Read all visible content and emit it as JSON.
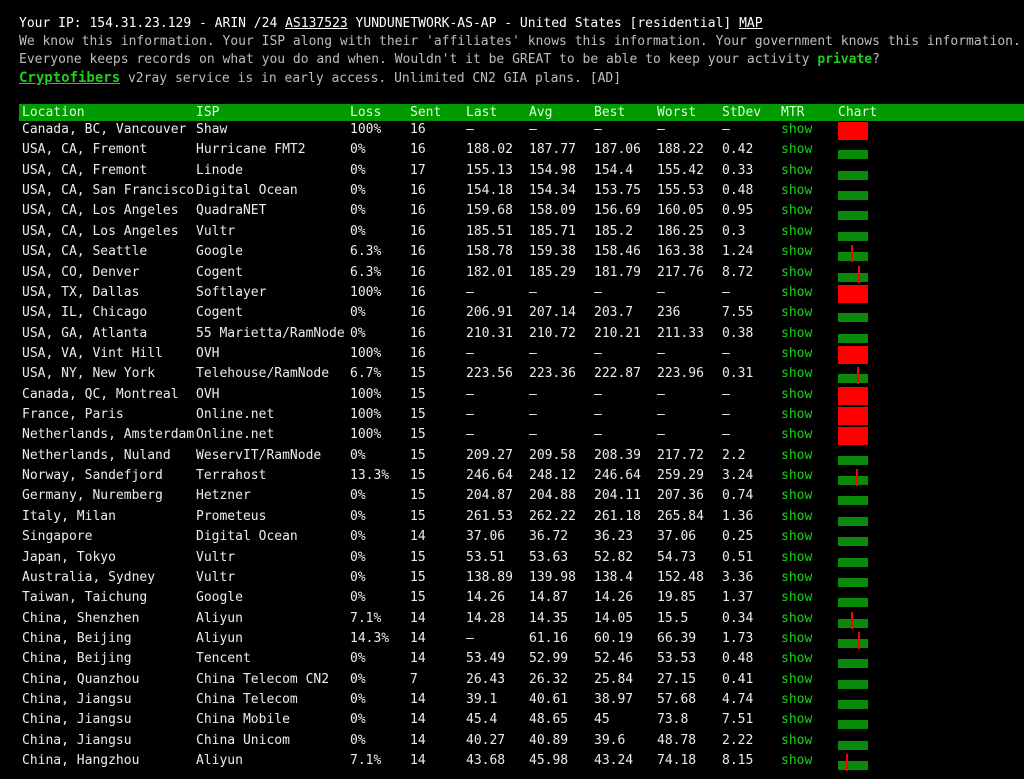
{
  "info": {
    "ip_label": "Your IP: 154.31.23.129 - ARIN /24 ",
    "asn": "AS137523",
    "asn_rest": " YUNDUNETWORK-AS-AP - United States [residential] ",
    "map_link": "MAP",
    "line2": "We know this information. Your ISP along with their 'affiliates' knows this information. Your government knows this information.",
    "line3_a": "Everyone keeps records on what you do and when. Wouldn't it be GREAT to be able to keep your activity ",
    "line3_private": "private",
    "line3_b": "?",
    "crypto_link": "Cryptofibers",
    "line4_rest": " v2ray service is in early access. Unlimited CN2 GIA plans. [AD]"
  },
  "columns": {
    "location": "Location",
    "isp": "ISP",
    "loss": "Loss",
    "sent": "Sent",
    "last": "Last",
    "avg": "Avg",
    "best": "Best",
    "worst": "Worst",
    "stdev": "StDev",
    "mtr": "MTR",
    "chart": "Chart"
  },
  "colors": {
    "header_bg": "#009b00",
    "link_green": "#1bd11b",
    "bar_green": "#0a8a0a",
    "bar_red": "#ff0000"
  },
  "rows": [
    {
      "location": "Canada, BC, Vancouver",
      "isp": "Shaw",
      "loss": "100%",
      "sent": "16",
      "last": "–",
      "avg": "–",
      "best": "–",
      "worst": "–",
      "stdev": "–",
      "mtr": "show",
      "chart": "down"
    },
    {
      "location": "USA, CA, Fremont",
      "isp": "Hurricane FMT2",
      "loss": "0%",
      "sent": "16",
      "last": "188.02",
      "avg": "187.77",
      "best": "187.06",
      "worst": "188.22",
      "stdev": "0.42",
      "mtr": "show",
      "chart": "ok"
    },
    {
      "location": "USA, CA, Fremont",
      "isp": "Linode",
      "loss": "0%",
      "sent": "17",
      "last": "155.13",
      "avg": "154.98",
      "best": "154.4",
      "worst": "155.42",
      "stdev": "0.33",
      "mtr": "show",
      "chart": "ok"
    },
    {
      "location": "USA, CA, San Francisco",
      "isp": "Digital Ocean",
      "loss": "0%",
      "sent": "16",
      "last": "154.18",
      "avg": "154.34",
      "best": "153.75",
      "worst": "155.53",
      "stdev": "0.48",
      "mtr": "show",
      "chart": "ok"
    },
    {
      "location": "USA, CA, Los Angeles",
      "isp": "QuadraNET",
      "loss": "0%",
      "sent": "16",
      "last": "159.68",
      "avg": "158.09",
      "best": "156.69",
      "worst": "160.05",
      "stdev": "0.95",
      "mtr": "show",
      "chart": "ok"
    },
    {
      "location": "USA, CA, Los Angeles",
      "isp": "Vultr",
      "loss": "0%",
      "sent": "16",
      "last": "185.51",
      "avg": "185.71",
      "best": "185.2",
      "worst": "186.25",
      "stdev": "0.3",
      "mtr": "show",
      "chart": "ok"
    },
    {
      "location": "USA, CA, Seattle",
      "isp": "Google",
      "loss": "6.3%",
      "sent": "16",
      "last": "158.78",
      "avg": "159.38",
      "best": "158.46",
      "worst": "163.38",
      "stdev": "1.24",
      "mtr": "show",
      "chart": "loss"
    },
    {
      "location": "USA, CO, Denver",
      "isp": "Cogent",
      "loss": "6.3%",
      "sent": "16",
      "last": "182.01",
      "avg": "185.29",
      "best": "181.79",
      "worst": "217.76",
      "stdev": "8.72",
      "mtr": "show",
      "chart": "loss"
    },
    {
      "location": "USA, TX, Dallas",
      "isp": "Softlayer",
      "loss": "100%",
      "sent": "16",
      "last": "–",
      "avg": "–",
      "best": "–",
      "worst": "–",
      "stdev": "–",
      "mtr": "show",
      "chart": "down"
    },
    {
      "location": "USA, IL, Chicago",
      "isp": "Cogent",
      "loss": "0%",
      "sent": "16",
      "last": "206.91",
      "avg": "207.14",
      "best": "203.7",
      "worst": "236",
      "stdev": "7.55",
      "mtr": "show",
      "chart": "ok"
    },
    {
      "location": "USA, GA, Atlanta",
      "isp": "55 Marietta/RamNode",
      "loss": "0%",
      "sent": "16",
      "last": "210.31",
      "avg": "210.72",
      "best": "210.21",
      "worst": "211.33",
      "stdev": "0.38",
      "mtr": "show",
      "chart": "ok"
    },
    {
      "location": "USA, VA, Vint Hill",
      "isp": "OVH",
      "loss": "100%",
      "sent": "16",
      "last": "–",
      "avg": "–",
      "best": "–",
      "worst": "–",
      "stdev": "–",
      "mtr": "show",
      "chart": "down"
    },
    {
      "location": "USA, NY, New York",
      "isp": "Telehouse/RamNode",
      "loss": "6.7%",
      "sent": "15",
      "last": "223.56",
      "avg": "223.36",
      "best": "222.87",
      "worst": "223.96",
      "stdev": "0.31",
      "mtr": "show",
      "chart": "loss"
    },
    {
      "location": "Canada, QC, Montreal",
      "isp": "OVH",
      "loss": "100%",
      "sent": "15",
      "last": "–",
      "avg": "–",
      "best": "–",
      "worst": "–",
      "stdev": "–",
      "mtr": "show",
      "chart": "down"
    },
    {
      "location": "France, Paris",
      "isp": "Online.net",
      "loss": "100%",
      "sent": "15",
      "last": "–",
      "avg": "–",
      "best": "–",
      "worst": "–",
      "stdev": "–",
      "mtr": "show",
      "chart": "down"
    },
    {
      "location": "Netherlands, Amsterdam",
      "isp": "Online.net",
      "loss": "100%",
      "sent": "15",
      "last": "–",
      "avg": "–",
      "best": "–",
      "worst": "–",
      "stdev": "–",
      "mtr": "show",
      "chart": "down"
    },
    {
      "location": "Netherlands, Nuland",
      "isp": "WeservIT/RamNode",
      "loss": "0%",
      "sent": "15",
      "last": "209.27",
      "avg": "209.58",
      "best": "208.39",
      "worst": "217.72",
      "stdev": "2.2",
      "mtr": "show",
      "chart": "ok"
    },
    {
      "location": "Norway, Sandefjord",
      "isp": "Terrahost",
      "loss": "13.3%",
      "sent": "15",
      "last": "246.64",
      "avg": "248.12",
      "best": "246.64",
      "worst": "259.29",
      "stdev": "3.24",
      "mtr": "show",
      "chart": "loss"
    },
    {
      "location": "Germany, Nuremberg",
      "isp": "Hetzner",
      "loss": "0%",
      "sent": "15",
      "last": "204.87",
      "avg": "204.88",
      "best": "204.11",
      "worst": "207.36",
      "stdev": "0.74",
      "mtr": "show",
      "chart": "ok"
    },
    {
      "location": "Italy, Milan",
      "isp": "Prometeus",
      "loss": "0%",
      "sent": "15",
      "last": "261.53",
      "avg": "262.22",
      "best": "261.18",
      "worst": "265.84",
      "stdev": "1.36",
      "mtr": "show",
      "chart": "ok"
    },
    {
      "location": "Singapore",
      "isp": "Digital Ocean",
      "loss": "0%",
      "sent": "14",
      "last": "37.06",
      "avg": "36.72",
      "best": "36.23",
      "worst": "37.06",
      "stdev": "0.25",
      "mtr": "show",
      "chart": "ok"
    },
    {
      "location": "Japan, Tokyo",
      "isp": "Vultr",
      "loss": "0%",
      "sent": "15",
      "last": "53.51",
      "avg": "53.63",
      "best": "52.82",
      "worst": "54.73",
      "stdev": "0.51",
      "mtr": "show",
      "chart": "ok"
    },
    {
      "location": "Australia, Sydney",
      "isp": "Vultr",
      "loss": "0%",
      "sent": "15",
      "last": "138.89",
      "avg": "139.98",
      "best": "138.4",
      "worst": "152.48",
      "stdev": "3.36",
      "mtr": "show",
      "chart": "ok"
    },
    {
      "location": "Taiwan, Taichung",
      "isp": "Google",
      "loss": "0%",
      "sent": "15",
      "last": "14.26",
      "avg": "14.87",
      "best": "14.26",
      "worst": "19.85",
      "stdev": "1.37",
      "mtr": "show",
      "chart": "ok"
    },
    {
      "location": "China, Shenzhen",
      "isp": "Aliyun",
      "loss": "7.1%",
      "sent": "14",
      "last": "14.28",
      "avg": "14.35",
      "best": "14.05",
      "worst": "15.5",
      "stdev": "0.34",
      "mtr": "show",
      "chart": "loss"
    },
    {
      "location": "China, Beijing",
      "isp": "Aliyun",
      "loss": "14.3%",
      "sent": "14",
      "last": "–",
      "avg": "61.16",
      "best": "60.19",
      "worst": "66.39",
      "stdev": "1.73",
      "mtr": "show",
      "chart": "loss"
    },
    {
      "location": "China, Beijing",
      "isp": "Tencent",
      "loss": "0%",
      "sent": "14",
      "last": "53.49",
      "avg": "52.99",
      "best": "52.46",
      "worst": "53.53",
      "stdev": "0.48",
      "mtr": "show",
      "chart": "ok"
    },
    {
      "location": "China, Quanzhou",
      "isp": "China Telecom CN2",
      "loss": "0%",
      "sent": "7",
      "last": "26.43",
      "avg": "26.32",
      "best": "25.84",
      "worst": "27.15",
      "stdev": "0.41",
      "mtr": "show",
      "chart": "ok"
    },
    {
      "location": "China, Jiangsu",
      "isp": "China Telecom",
      "loss": "0%",
      "sent": "14",
      "last": "39.1",
      "avg": "40.61",
      "best": "38.97",
      "worst": "57.68",
      "stdev": "4.74",
      "mtr": "show",
      "chart": "ok"
    },
    {
      "location": "China, Jiangsu",
      "isp": "China Mobile",
      "loss": "0%",
      "sent": "14",
      "last": "45.4",
      "avg": "48.65",
      "best": "45",
      "worst": "73.8",
      "stdev": "7.51",
      "mtr": "show",
      "chart": "ok"
    },
    {
      "location": "China, Jiangsu",
      "isp": "China Unicom",
      "loss": "0%",
      "sent": "14",
      "last": "40.27",
      "avg": "40.89",
      "best": "39.6",
      "worst": "48.78",
      "stdev": "2.22",
      "mtr": "show",
      "chart": "ok"
    },
    {
      "location": "China, Hangzhou",
      "isp": "Aliyun",
      "loss": "7.1%",
      "sent": "14",
      "last": "43.68",
      "avg": "45.98",
      "best": "43.24",
      "worst": "74.18",
      "stdev": "8.15",
      "mtr": "show",
      "chart": "loss"
    }
  ]
}
